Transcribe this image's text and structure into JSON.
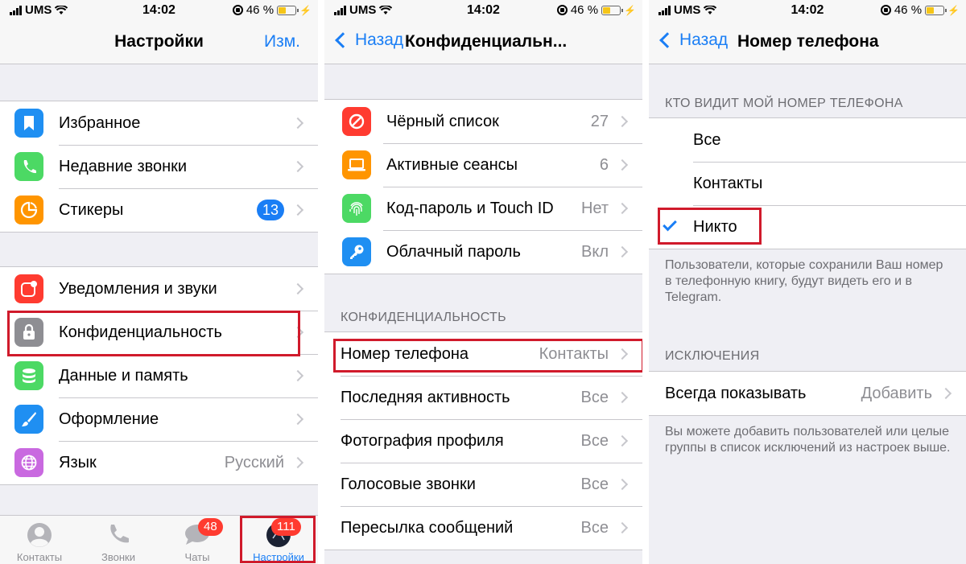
{
  "status": {
    "carrier": "UMS",
    "time": "14:02",
    "battery": "46 %"
  },
  "screen1": {
    "title": "Настройки",
    "edit": "Изм.",
    "group1": [
      {
        "label": "Избранное",
        "icon": "bookmark-icon"
      },
      {
        "label": "Недавние звонки",
        "icon": "phone-icon"
      },
      {
        "label": "Стикеры",
        "icon": "sticker-icon",
        "badge": "13"
      }
    ],
    "group2": [
      {
        "label": "Уведомления и звуки",
        "icon": "notification-icon"
      },
      {
        "label": "Конфиденциальность",
        "icon": "lock-icon"
      },
      {
        "label": "Данные и память",
        "icon": "database-icon"
      },
      {
        "label": "Оформление",
        "icon": "brush-icon"
      },
      {
        "label": "Язык",
        "icon": "globe-icon",
        "value": "Русский"
      }
    ],
    "tabs": [
      {
        "label": "Контакты",
        "icon": "contacts-icon"
      },
      {
        "label": "Звонки",
        "icon": "phone-icon"
      },
      {
        "label": "Чаты",
        "icon": "chat-icon",
        "badge": "48"
      },
      {
        "label": "Настройки",
        "icon": "settings-avatar-icon",
        "badge": "111"
      }
    ]
  },
  "screen2": {
    "back": "Назад",
    "title": "Конфиденциальн...",
    "group1": [
      {
        "label": "Чёрный список",
        "value": "27",
        "icon": "block-icon"
      },
      {
        "label": "Активные сеансы",
        "value": "6",
        "icon": "laptop-icon"
      },
      {
        "label": "Код-пароль и Touch ID",
        "value": "Нет",
        "icon": "fingerprint-icon"
      },
      {
        "label": "Облачный пароль",
        "value": "Вкл",
        "icon": "key-icon"
      }
    ],
    "section_header": "КОНФИДЕНЦИАЛЬНОСТЬ",
    "group2": [
      {
        "label": "Номер телефона",
        "value": "Контакты"
      },
      {
        "label": "Последняя активность",
        "value": "Все"
      },
      {
        "label": "Фотография профиля",
        "value": "Все"
      },
      {
        "label": "Голосовые звонки",
        "value": "Все"
      },
      {
        "label": "Пересылка сообщений",
        "value": "Все"
      }
    ]
  },
  "screen3": {
    "back": "Назад",
    "title": "Номер телефона",
    "section_header": "КТО ВИДИТ МОЙ НОМЕР ТЕЛЕФОНА",
    "options": [
      "Все",
      "Контакты",
      "Никто"
    ],
    "selected": "Никто",
    "note1": "Пользователи, которые сохранили Ваш номер в телефонную книгу, будут видеть его и в Telegram.",
    "exceptions_header": "ИСКЛЮЧЕНИЯ",
    "always_show": {
      "label": "Всегда показывать",
      "value": "Добавить"
    },
    "note2": "Вы можете добавить пользователей или целые группы в список исключений из настроек выше."
  },
  "colors": {
    "accent": "#1a7ef5",
    "highlight": "#d01a2b",
    "badge_red": "#ff3b30",
    "icon_blue": "#1f8ff2",
    "icon_green": "#4cd964",
    "icon_orange": "#ff9500",
    "icon_red": "#ff3b30",
    "icon_gray": "#8e8e93",
    "icon_teal": "#5ac8fa",
    "icon_purple": "#c969e0",
    "icon_green2": "#4cd964"
  }
}
